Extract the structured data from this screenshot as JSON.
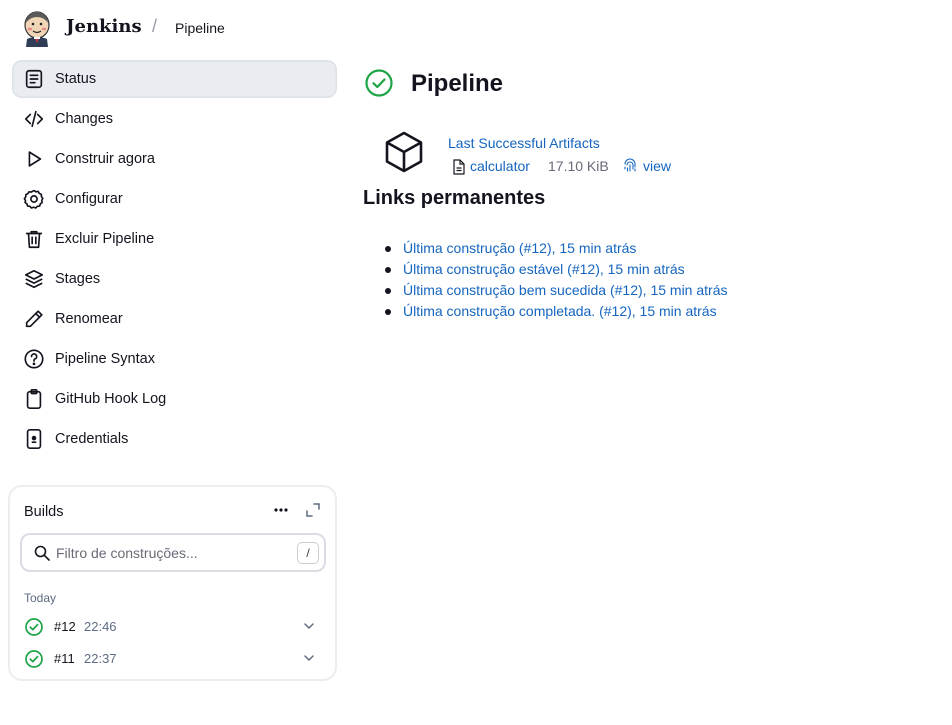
{
  "header": {
    "brand": "Jenkins",
    "separator": "/",
    "breadcrumb": "Pipeline"
  },
  "sidebar": {
    "items": [
      {
        "label": "Status",
        "icon": "status-document-icon",
        "active": true
      },
      {
        "label": "Changes",
        "icon": "code-icon"
      },
      {
        "label": "Construir agora",
        "icon": "play-icon"
      },
      {
        "label": "Configurar",
        "icon": "gear-icon"
      },
      {
        "label": "Excluir Pipeline",
        "icon": "trash-icon"
      },
      {
        "label": "Stages",
        "icon": "layers-icon"
      },
      {
        "label": "Renomear",
        "icon": "pencil-icon"
      },
      {
        "label": "Pipeline Syntax",
        "icon": "help-icon"
      },
      {
        "label": "GitHub Hook Log",
        "icon": "clipboard-icon"
      },
      {
        "label": "Credentials",
        "icon": "phone-key-icon"
      }
    ]
  },
  "builds": {
    "title": "Builds",
    "filter_placeholder": "Filtro de construções...",
    "filter_shortcut": "/",
    "day": "Today",
    "items": [
      {
        "number": "#12",
        "time": "22:46",
        "status": "success"
      },
      {
        "number": "#11",
        "time": "22:37",
        "status": "success"
      }
    ]
  },
  "main": {
    "title": "Pipeline",
    "status": "success",
    "artifacts": {
      "heading_link": "Last Successful Artifacts",
      "file": "calculator",
      "size": "17.10 KiB",
      "view_label": "view"
    },
    "permalinks_title": "Links permanentes",
    "permalinks": [
      "Última construção (#12), 15 min atrás",
      "Última construção estável (#12), 15 min atrás",
      "Última construção bem sucedida (#12), 15 min atrás",
      "Última construção completada. (#12), 15 min atrás"
    ]
  },
  "colors": {
    "link": "#1565c0",
    "success": "#1ea446",
    "active_bg": "#e9ecf1"
  }
}
